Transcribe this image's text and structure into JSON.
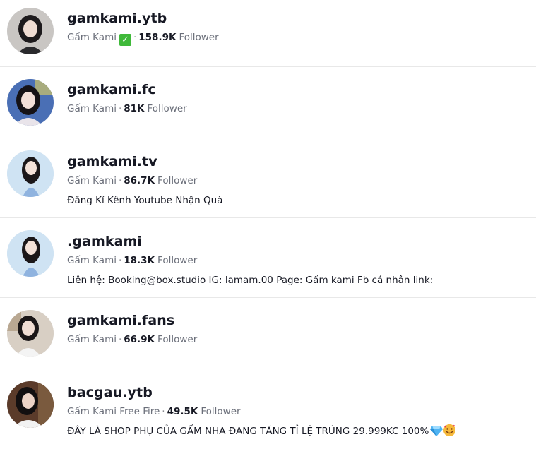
{
  "results": [
    {
      "username": "gamkami.ytb",
      "nickname": "Gấm Kami",
      "verified_emoji": "check-mark-button",
      "followers": "158.9K",
      "follower_label": "Follower",
      "bio": "",
      "avatar": {
        "bg": "#c9c6c3",
        "hair": "#1d1a1c",
        "skin": "#efdcd2",
        "cloth": "#2a2a2d"
      }
    },
    {
      "username": "gamkami.fc",
      "nickname": "Gấm Kami",
      "followers": "81K",
      "follower_label": "Follower",
      "bio": "",
      "avatar": {
        "bg": "#4a6fb5",
        "hair": "#151216",
        "skin": "#f2dfd8",
        "cloth": "#e9e4ea"
      }
    },
    {
      "username": "gamkami.tv",
      "nickname": "Gấm Kami",
      "followers": "86.7K",
      "follower_label": "Follower",
      "bio": "Đăng Kí Kênh Youtube Nhận Quà",
      "avatar": {
        "bg": "#cfe3f3",
        "hair": "#1b1719",
        "skin": "#f3e1d8",
        "cloth": "#8fb3df"
      }
    },
    {
      "username": ".gamkami",
      "nickname": "Gấm Kami",
      "followers": "18.3K",
      "follower_label": "Follower",
      "bio": "Liên hệ: Booking@box.studio IG: lamam.00 Page: Gấm kami Fb cá nhân link:",
      "avatar": {
        "bg": "#cfe3f3",
        "hair": "#1b1719",
        "skin": "#f3e1d8",
        "cloth": "#8fb3df"
      }
    },
    {
      "username": "gamkami.fans",
      "nickname": "Gấm Kami",
      "followers": "66.9K",
      "follower_label": "Follower",
      "bio": "",
      "avatar": {
        "bg": "#d8cfc4",
        "hair": "#1a1617",
        "skin": "#f0ddd3",
        "cloth": "#f4f4f4"
      }
    },
    {
      "username": "bacgau.ytb",
      "nickname": "Gấm Kami Free Fire",
      "followers": "49.5K",
      "follower_label": "Follower",
      "bio": "ĐÂY LÀ SHOP PHỤ CỦA GẤM NHA ĐANG TĂNG TỈ LỆ TRÚNG 29.999KC 100%",
      "bio_emojis": [
        "gem-stone-icon",
        "smiling-face-with-hearts-icon"
      ],
      "avatar": {
        "bg": "#5b3b2a",
        "hair": "#120f10",
        "skin": "#ecd3c6",
        "cloth": "#f2f2f2"
      }
    }
  ]
}
